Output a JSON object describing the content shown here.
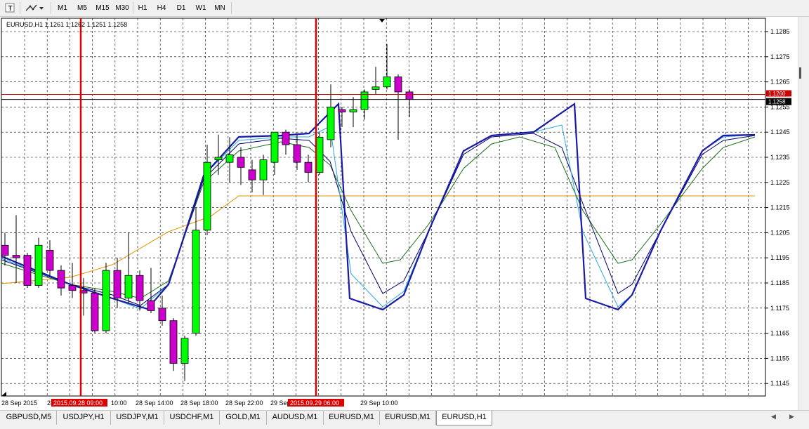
{
  "toolbar": {
    "timeframes": [
      "M1",
      "M5",
      "M15",
      "M30",
      "H1",
      "H4",
      "D1",
      "W1",
      "MN"
    ]
  },
  "chart": {
    "info_line": "EURUSD,H1  1.1261 1.1262 1.1251 1.1258",
    "price_labels": [
      "1.1285",
      "1.1275",
      "1.1265",
      "1.1255",
      "1.1245",
      "1.1235",
      "1.1225",
      "1.1215",
      "1.1205",
      "1.1195",
      "1.1185",
      "1.1175",
      "1.1165",
      "1.1155",
      "1.1145"
    ],
    "current_price_tag": "1.1258",
    "red_price_tag": "1.1260",
    "time_labels": [
      "28 Sep 2015",
      "28",
      "10:00",
      "28 Sep 14:00",
      "28 Sep 18:00",
      "28 Sep 22:00",
      "29 Sep",
      "29 Sep 10:00"
    ],
    "vline_tags": [
      "2015.09.28 09:00",
      "2015.09.29 06:00"
    ],
    "colors": {
      "bull": "#00ff00",
      "bear": "#cc00cc",
      "grid": "#000000",
      "vline": "#dd0000",
      "dark_blue": "#1a1aa8",
      "light_blue": "#2aa8e0",
      "navy": "#000066",
      "green_line": "#1a6b1a",
      "orange_line": "#e09000",
      "red_hline": "#cc0000"
    }
  },
  "tabs": [
    "GBPUSD,M5",
    "USDJPY,H1",
    "USDJPY,M1",
    "USDCHF,M1",
    "GOLD,M1",
    "AUDUSD,M1",
    "EURUSD,M1",
    "EURUSD,M1",
    "EURUSD,H1"
  ],
  "active_tab": "EURUSD,H1",
  "chart_data": {
    "type": "candlestick",
    "series": [
      {
        "values": [
          [
            1.12,
            1.1205,
            1.1192,
            1.1196
          ],
          [
            1.1196,
            1.1212,
            1.1185,
            1.1195
          ],
          [
            1.1196,
            1.1197,
            1.1183,
            1.1184
          ],
          [
            1.1184,
            1.1203,
            1.1183,
            1.12
          ],
          [
            1.1198,
            1.1202,
            1.1188,
            1.119
          ],
          [
            1.119,
            1.1192,
            1.118,
            1.1183
          ],
          [
            1.1184,
            1.1193,
            1.1179,
            1.1182
          ],
          [
            1.1182,
            1.1187,
            1.1172,
            1.1181
          ],
          [
            1.1181,
            1.1183,
            1.1165,
            1.1166
          ],
          [
            1.1166,
            1.1193,
            1.1165,
            1.119
          ],
          [
            1.119,
            1.1195,
            1.1175,
            1.1179
          ],
          [
            1.1179,
            1.1205,
            1.1177,
            1.1188
          ],
          [
            1.1188,
            1.119,
            1.1174,
            1.1178
          ],
          [
            1.1178,
            1.1191,
            1.1173,
            1.1174
          ],
          [
            1.1175,
            1.118,
            1.1168,
            1.117
          ],
          [
            1.117,
            1.1171,
            1.115,
            1.1153
          ],
          [
            1.1153,
            1.1164,
            1.1146,
            1.1163
          ],
          [
            1.1165,
            1.1215,
            1.1164,
            1.1206
          ],
          [
            1.1206,
            1.124,
            1.1204,
            1.1233
          ],
          [
            1.1234,
            1.1244,
            1.1228,
            1.1235
          ],
          [
            1.1233,
            1.1243,
            1.1225,
            1.1236
          ],
          [
            1.1235,
            1.1239,
            1.1224,
            1.1231
          ],
          [
            1.123,
            1.1234,
            1.1221,
            1.1226
          ],
          [
            1.1226,
            1.1236,
            1.122,
            1.1234
          ],
          [
            1.1233,
            1.1245,
            1.1228,
            1.1245
          ],
          [
            1.1245,
            1.1246,
            1.1236,
            1.124
          ],
          [
            1.124,
            1.1244,
            1.123,
            1.1233
          ],
          [
            1.1233,
            1.1236,
            1.1225,
            1.1229
          ],
          [
            1.1229,
            1.1245,
            1.1228,
            1.1243
          ],
          [
            1.1242,
            1.1264,
            1.1239,
            1.1255
          ],
          [
            1.1254,
            1.1255,
            1.1247,
            1.1253
          ],
          [
            1.1253,
            1.1259,
            1.1247,
            1.1254
          ],
          [
            1.1254,
            1.1262,
            1.125,
            1.1261
          ],
          [
            1.1262,
            1.1271,
            1.126,
            1.1263
          ],
          [
            1.1263,
            1.128,
            1.1262,
            1.1267
          ],
          [
            1.1267,
            1.1268,
            1.1242,
            1.1261
          ],
          [
            1.1261,
            1.1262,
            1.1251,
            1.1258
          ]
        ]
      }
    ]
  }
}
